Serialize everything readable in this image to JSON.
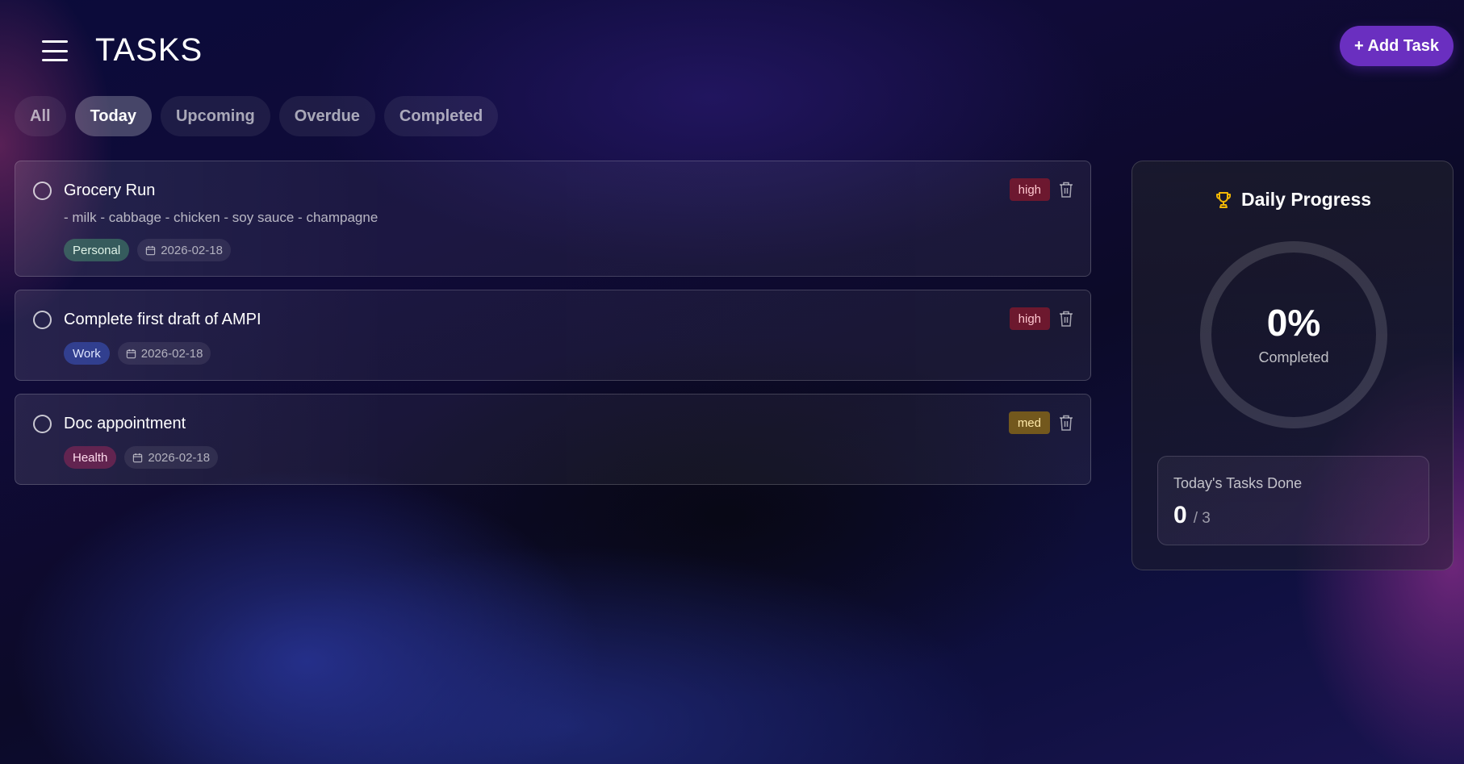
{
  "header": {
    "title": "TASKS",
    "add_button_label": "+ Add Task"
  },
  "tabs": [
    {
      "label": "All",
      "active": false
    },
    {
      "label": "Today",
      "active": true
    },
    {
      "label": "Upcoming",
      "active": false
    },
    {
      "label": "Overdue",
      "active": false
    },
    {
      "label": "Completed",
      "active": false
    }
  ],
  "tasks": [
    {
      "title": "Grocery Run",
      "description": "- milk - cabbage - chicken - soy sauce - champagne",
      "category": "Personal",
      "date": "2026-02-18",
      "priority": "high",
      "completed": false
    },
    {
      "title": "Complete first draft of AMPI",
      "category": "Work",
      "date": "2026-02-18",
      "priority": "high",
      "completed": false
    },
    {
      "title": "Doc appointment",
      "category": "Health",
      "date": "2026-02-18",
      "priority": "med",
      "completed": false
    }
  ],
  "progress": {
    "title": "Daily Progress",
    "percent_text": "0%",
    "percent_value": 0,
    "percent_label": "Completed",
    "stats_label": "Today's Tasks Done",
    "done": "0",
    "total": "/ 3"
  },
  "colors": {
    "accent": "#6a2fc0",
    "trophy": "#f2b705",
    "priority_high": "#821a2d",
    "priority_med": "#826419"
  },
  "icons": {
    "menu": "hamburger-menu-icon",
    "task_check": "circle-checkbox-icon",
    "date": "calendar-icon",
    "delete": "trash-icon",
    "progress": "trophy-icon"
  }
}
